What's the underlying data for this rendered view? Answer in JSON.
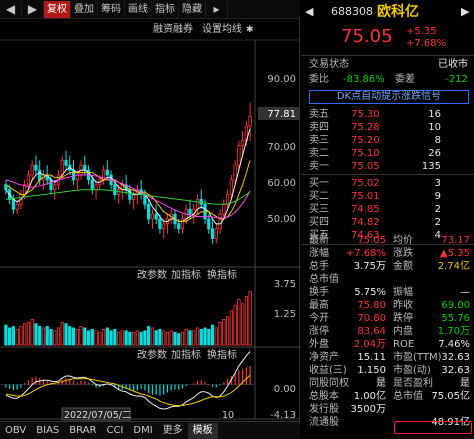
{
  "toolbar": {
    "prev": "◀",
    "next": "▶",
    "items": [
      "复权",
      "叠加",
      "筹码",
      "画线",
      "指标",
      "隐藏"
    ],
    "active": "复权",
    "overflow": "▸"
  },
  "chart": {
    "sub_labels": {
      "financing": "融资融券",
      "ma_setting": "设置均线"
    },
    "price_axis": [
      "90.00",
      "77.81",
      "70.00",
      "60.00",
      "50.00"
    ],
    "vol_labels": {
      "params": "改参数",
      "add": "加指标",
      "switch": "换指标"
    },
    "vol_axis": [
      "3.75",
      "1.25"
    ],
    "macd_labels": {
      "params": "改参数",
      "add": "加指标",
      "switch": "换指标"
    },
    "macd_axis": [
      "0.00",
      "-4.13"
    ],
    "date_label": "2022/07/05/二",
    "month_label": "10",
    "tabs": [
      "OBV",
      "BIAS",
      "BRAR",
      "CCI",
      "DMI",
      "更多",
      "模板"
    ],
    "active_tab": "模板"
  },
  "quote": {
    "code": "688308",
    "name": "欧科亿",
    "price": "75.05",
    "change": "+5.35",
    "change_pct": "+7.68%",
    "status_label": "交易状态",
    "status_value": "已收市",
    "weibi_label": "委比",
    "weibi_value": "-83.86%",
    "weicha_label": "委差",
    "weicha_value": "-212",
    "dk_banner": "DK点自动提示涨跌信号",
    "asks": [
      {
        "label": "卖五",
        "price": "75.30",
        "vol": "16"
      },
      {
        "label": "卖四",
        "price": "75.28",
        "vol": "10"
      },
      {
        "label": "卖三",
        "price": "75.20",
        "vol": "8"
      },
      {
        "label": "卖二",
        "price": "75.10",
        "vol": "26"
      },
      {
        "label": "卖一",
        "price": "75.05",
        "vol": "135"
      }
    ],
    "bids": [
      {
        "label": "买一",
        "price": "75.02",
        "vol": "3"
      },
      {
        "label": "买二",
        "price": "75.01",
        "vol": "9"
      },
      {
        "label": "买三",
        "price": "74.85",
        "vol": "2"
      },
      {
        "label": "买四",
        "price": "74.82",
        "vol": "2"
      },
      {
        "label": "买五",
        "price": "74.63",
        "vol": "4"
      }
    ],
    "stats": [
      {
        "l1": "最新",
        "v1": "75.05",
        "c1": "red",
        "l2": "均价",
        "v2": "73.17",
        "c2": "red"
      },
      {
        "l1": "涨幅",
        "v1": "+7.68%",
        "c1": "red",
        "l2": "涨跌",
        "v2": "▲5.35",
        "c2": "red"
      },
      {
        "l1": "总手",
        "v1": "3.75万",
        "c1": "white",
        "l2": "金额",
        "v2": "2.74亿",
        "c2": "yellow"
      },
      {
        "l1": "总市值",
        "v1": "",
        "c1": "white",
        "l2": "",
        "v2": "",
        "c2": "white"
      },
      {
        "l1": "换手",
        "v1": "5.75%",
        "c1": "white",
        "l2": "振幅",
        "v2": "—",
        "c2": "white"
      },
      {
        "l1": "最高",
        "v1": "75.80",
        "c1": "red",
        "l2": "昨收",
        "v2": "69.00",
        "c2": "green"
      },
      {
        "l1": "今开",
        "v1": "70.80",
        "c1": "red",
        "l2": "跌停",
        "v2": "55.76",
        "c2": "green"
      },
      {
        "l1": "涨停",
        "v1": "83.64",
        "c1": "red",
        "l2": "内盘",
        "v2": "1.70万",
        "c2": "green"
      },
      {
        "l1": "外盘",
        "v1": "2.04万",
        "c1": "red",
        "l2": "ROE",
        "v2": "7.46%",
        "c2": "white"
      },
      {
        "l1": "净资产",
        "v1": "15.11",
        "c1": "white",
        "l2": "市盈(TTM)",
        "v2": "32.63",
        "c2": "white"
      },
      {
        "l1": "收益(三)",
        "v1": "1.150",
        "c1": "white",
        "l2": "市盈(动)",
        "v2": "32.63",
        "c2": "white"
      },
      {
        "l1": "同股同权",
        "v1": "是",
        "c1": "white",
        "l2": "是否盈利",
        "v2": "是",
        "c2": "white"
      },
      {
        "l1": "总股本",
        "v1": "1.00亿",
        "c1": "white",
        "l2": "总市值",
        "v2": "75.05亿",
        "c2": "white"
      },
      {
        "l1": "发行股",
        "v1": "3500万",
        "c1": "white",
        "l2": "",
        "v2": "",
        "c2": "white"
      },
      {
        "l1": "流通股",
        "v1": "",
        "c1": "white",
        "l2": "",
        "v2": "48.91亿",
        "c2": "white"
      }
    ]
  },
  "chart_data": {
    "type": "candlestick",
    "price_ylim": [
      45,
      90
    ],
    "candles": [
      [
        61,
        62,
        59,
        60
      ],
      [
        60,
        61,
        57,
        58
      ],
      [
        58,
        59,
        55,
        56
      ],
      [
        56,
        58,
        55,
        57
      ],
      [
        57,
        60,
        56,
        59
      ],
      [
        59,
        62,
        58,
        61
      ],
      [
        61,
        64,
        60,
        63
      ],
      [
        63,
        66,
        62,
        65
      ],
      [
        65,
        67,
        63,
        64
      ],
      [
        64,
        66,
        61,
        62
      ],
      [
        62,
        64,
        60,
        63
      ],
      [
        63,
        65,
        61,
        62
      ],
      [
        62,
        63,
        59,
        60
      ],
      [
        60,
        62,
        58,
        61
      ],
      [
        61,
        64,
        60,
        63
      ],
      [
        63,
        67,
        62,
        66
      ],
      [
        66,
        68,
        64,
        65
      ],
      [
        65,
        67,
        63,
        64
      ],
      [
        64,
        66,
        61,
        62
      ],
      [
        62,
        64,
        60,
        63
      ],
      [
        63,
        66,
        62,
        65
      ],
      [
        65,
        67,
        63,
        64
      ],
      [
        64,
        65,
        61,
        62
      ],
      [
        62,
        63,
        59,
        60
      ],
      [
        60,
        62,
        58,
        61
      ],
      [
        61,
        63,
        60,
        62
      ],
      [
        62,
        65,
        61,
        64
      ],
      [
        64,
        66,
        62,
        63
      ],
      [
        63,
        64,
        60,
        61
      ],
      [
        61,
        62,
        58,
        59
      ],
      [
        59,
        61,
        57,
        60
      ],
      [
        60,
        62,
        58,
        61
      ],
      [
        61,
        63,
        59,
        60
      ],
      [
        60,
        61,
        57,
        58
      ],
      [
        58,
        60,
        56,
        59
      ],
      [
        59,
        61,
        57,
        60
      ],
      [
        60,
        62,
        58,
        59
      ],
      [
        59,
        60,
        56,
        57
      ],
      [
        57,
        58,
        53,
        54
      ],
      [
        54,
        56,
        52,
        55
      ],
      [
        55,
        57,
        53,
        54
      ],
      [
        54,
        55,
        51,
        52
      ],
      [
        52,
        54,
        50,
        53
      ],
      [
        53,
        55,
        51,
        54
      ],
      [
        54,
        56,
        53,
        55
      ],
      [
        55,
        56,
        52,
        53
      ],
      [
        53,
        54,
        51,
        52
      ],
      [
        52,
        55,
        51,
        54
      ],
      [
        54,
        57,
        53,
        56
      ],
      [
        56,
        58,
        54,
        55
      ],
      [
        55,
        57,
        53,
        56
      ],
      [
        56,
        59,
        55,
        58
      ],
      [
        58,
        60,
        56,
        57
      ],
      [
        57,
        58,
        53,
        54
      ],
      [
        54,
        55,
        51,
        52
      ],
      [
        52,
        54,
        49,
        50
      ],
      [
        50,
        53,
        49,
        52
      ],
      [
        52,
        56,
        51,
        55
      ],
      [
        55,
        58,
        54,
        57
      ],
      [
        57,
        60,
        56,
        59
      ],
      [
        59,
        63,
        58,
        62
      ],
      [
        62,
        66,
        61,
        65
      ],
      [
        65,
        70,
        64,
        69
      ],
      [
        69,
        72,
        67,
        70
      ],
      [
        70,
        74,
        69,
        73
      ],
      [
        73,
        77.81,
        70,
        75
      ]
    ],
    "ma5": [
      60,
      59,
      58,
      57.5,
      58,
      59,
      60,
      62,
      63,
      63.5,
      63,
      63,
      62,
      61.5,
      62,
      63,
      64,
      64.5,
      64,
      63.5,
      64,
      64,
      63.5,
      62.5,
      61.5,
      61.5,
      62,
      62.5,
      62.5,
      61.5,
      60.5,
      60,
      60,
      59.5,
      59,
      59,
      59.5,
      59,
      58,
      56.5,
      55.5,
      54.5,
      53.5,
      53.5,
      54,
      54,
      53.5,
      53.5,
      54,
      54.5,
      55,
      56,
      56.5,
      56,
      55.5,
      54,
      53,
      53,
      54,
      56,
      58,
      61,
      64,
      67,
      70,
      72.5
    ],
    "ma10": [
      61,
      60.5,
      60,
      59.5,
      59,
      59,
      59.5,
      60,
      61,
      62,
      62.5,
      63,
      63,
      62.5,
      62.5,
      62.5,
      63,
      63.5,
      63.5,
      63.5,
      63.5,
      63.5,
      63.5,
      63.5,
      63,
      62.5,
      62,
      62,
      62,
      62,
      61.5,
      61,
      60.5,
      60,
      60,
      59.5,
      59.5,
      59.5,
      59,
      58.5,
      57.5,
      56.5,
      55.5,
      55,
      54.5,
      54,
      53.5,
      53.5,
      53.5,
      54,
      54.5,
      55,
      55.5,
      55.5,
      55.5,
      55,
      54.5,
      54,
      54,
      54.5,
      55.5,
      57,
      59,
      61,
      63.5,
      66
    ],
    "ma20": [
      62,
      61.8,
      61.5,
      61.2,
      61,
      60.8,
      60.6,
      60.5,
      60.6,
      60.8,
      61,
      61.2,
      61.5,
      61.8,
      62,
      62.2,
      62.4,
      62.6,
      62.8,
      63,
      63,
      63,
      63,
      62.9,
      62.8,
      62.6,
      62.4,
      62.2,
      62,
      61.8,
      61.5,
      61.2,
      61,
      60.6,
      60.2,
      59.8,
      59.4,
      59,
      58.6,
      58.2,
      57.8,
      57.4,
      57,
      56.6,
      56.2,
      55.8,
      55.5,
      55.2,
      55,
      54.8,
      54.6,
      54.5,
      54.5,
      54.5,
      54.5,
      54.4,
      54.3,
      54.2,
      54.2,
      54.4,
      54.8,
      55.4,
      56.2,
      57.2,
      58.4,
      59.8
    ],
    "ma60": [
      58,
      58.1,
      58.2,
      58.3,
      58.4,
      58.5,
      58.6,
      58.7,
      58.8,
      58.9,
      59,
      59.1,
      59.2,
      59.3,
      59.4,
      59.5,
      59.6,
      59.7,
      59.8,
      59.9,
      60,
      60,
      60,
      60,
      60,
      60,
      60,
      59.9,
      59.8,
      59.7,
      59.6,
      59.5,
      59.4,
      59.3,
      59.2,
      59.1,
      59,
      58.9,
      58.8,
      58.7,
      58.6,
      58.5,
      58.4,
      58.3,
      58.2,
      58.1,
      58,
      57.9,
      57.8,
      57.7,
      57.6,
      57.5,
      57.4,
      57.3,
      57.2,
      57.1,
      57,
      57,
      57,
      57.1,
      57.3,
      57.6,
      58,
      58.5,
      59,
      59.6
    ],
    "volume_ylim": [
      0,
      4.5
    ],
    "volume": [
      1.4,
      1.2,
      1.3,
      1.1,
      1.3,
      1.5,
      1.6,
      1.8,
      1.5,
      1.3,
      1.2,
      1.3,
      1.1,
      1.0,
      1.2,
      1.6,
      1.5,
      1.3,
      1.2,
      1.1,
      1.3,
      1.2,
      1.0,
      1.1,
      1.0,
      0.9,
      1.1,
      1.2,
      1.0,
      1.1,
      0.9,
      1.0,
      1.0,
      0.9,
      0.9,
      1.0,
      0.9,
      1.0,
      1.3,
      1.2,
      1.0,
      1.1,
      1.0,
      0.9,
      1.0,
      0.9,
      0.8,
      0.9,
      1.1,
      1.0,
      1.0,
      1.2,
      1.1,
      1.2,
      1.1,
      1.4,
      1.2,
      1.6,
      1.8,
      2.0,
      2.4,
      2.8,
      3.2,
      2.9,
      3.4,
      3.75
    ],
    "macd_ylim": [
      -4.5,
      3
    ],
    "macd_hist": [
      -0.4,
      -0.6,
      -0.8,
      -0.7,
      -0.4,
      0.2,
      0.6,
      1.0,
      1.1,
      0.9,
      0.7,
      0.6,
      0.3,
      0.1,
      0.3,
      0.7,
      0.9,
      0.8,
      0.5,
      0.3,
      0.5,
      0.5,
      0.3,
      -0.1,
      -0.4,
      -0.4,
      -0.2,
      0,
      -0.1,
      -0.4,
      -0.7,
      -0.7,
      -0.6,
      -0.8,
      -0.9,
      -0.8,
      -0.6,
      -0.8,
      -1.2,
      -1.4,
      -1.4,
      -1.5,
      -1.4,
      -1.1,
      -0.8,
      -0.7,
      -0.7,
      -0.5,
      -0.2,
      0,
      0.2,
      0.5,
      0.6,
      0.4,
      0.1,
      -0.3,
      -0.4,
      -0.1,
      0.3,
      0.8,
      1.2,
      1.6,
      2.0,
      2.2,
      2.4,
      2.6
    ],
    "dif": [
      -1.5,
      -1.7,
      -1.9,
      -1.9,
      -1.6,
      -1.1,
      -0.6,
      0,
      0.4,
      0.5,
      0.6,
      0.6,
      0.5,
      0.4,
      0.5,
      0.9,
      1.2,
      1.2,
      1.0,
      0.9,
      1.0,
      1.0,
      0.8,
      0.4,
      0,
      -0.1,
      0,
      0.1,
      0,
      -0.3,
      -0.7,
      -0.9,
      -1.0,
      -1.3,
      -1.5,
      -1.6,
      -1.6,
      -1.8,
      -2.3,
      -2.7,
      -3.0,
      -3.3,
      -3.4,
      -3.3,
      -3.1,
      -3.0,
      -3.0,
      -2.8,
      -2.4,
      -2.1,
      -1.8,
      -1.3,
      -1.0,
      -1.0,
      -1.2,
      -1.6,
      -1.8,
      -1.6,
      -1.0,
      -0.2,
      0.7,
      1.6,
      2.6,
      3.3,
      4.0,
      4.6
    ],
    "dea": [
      -1.3,
      -1.4,
      -1.5,
      -1.6,
      -1.6,
      -1.5,
      -1.3,
      -1.0,
      -0.7,
      -0.4,
      -0.2,
      0,
      0.1,
      0.2,
      0.3,
      0.4,
      0.6,
      0.7,
      0.8,
      0.8,
      0.8,
      0.8,
      0.8,
      0.7,
      0.6,
      0.5,
      0.4,
      0.3,
      0.2,
      0.1,
      -0.1,
      -0.3,
      -0.5,
      -0.7,
      -0.9,
      -1.1,
      -1.3,
      -1.4,
      -1.6,
      -1.8,
      -2.0,
      -2.3,
      -2.5,
      -2.7,
      -2.8,
      -2.9,
      -2.9,
      -2.9,
      -2.8,
      -2.7,
      -2.6,
      -2.4,
      -2.2,
      -2.0,
      -1.8,
      -1.7,
      -1.7,
      -1.7,
      -1.6,
      -1.4,
      -1.1,
      -0.7,
      -0.2,
      0.3,
      0.8,
      1.3
    ],
    "colors": {
      "up": "#ff3232",
      "down": "#00e0e0",
      "ma5": "#f0f0f0",
      "ma10": "#f0c800",
      "ma20": "#ff40ff",
      "ma60": "#30d030"
    }
  }
}
